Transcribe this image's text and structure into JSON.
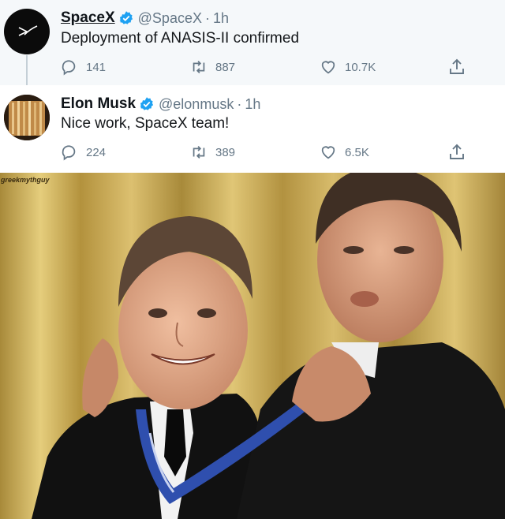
{
  "tweets": [
    {
      "display_name": "SpaceX",
      "handle": "@SpaceX",
      "separator": "·",
      "time": "1h",
      "text": "Deployment of ANASIS-II confirmed",
      "replies": "141",
      "retweets": "887",
      "likes": "10.7K",
      "avatar_icon": "spacex-logo"
    },
    {
      "display_name": "Elon Musk",
      "handle": "@elonmusk",
      "separator": "·",
      "time": "1h",
      "text": "Nice work, SpaceX team!",
      "replies": "224",
      "retweets": "389",
      "likes": "6.5K",
      "avatar_icon": "profile-photo"
    }
  ],
  "meme": {
    "watermark": "greekmythguy"
  },
  "colors": {
    "verified": "#1da1f2",
    "muted": "#657786",
    "text": "#14171a",
    "curtain": "#c9a441",
    "medal_ribbon": "#2f4fae"
  },
  "icons": [
    "verified-badge-icon",
    "reply-icon",
    "retweet-icon",
    "like-icon",
    "share-icon"
  ]
}
